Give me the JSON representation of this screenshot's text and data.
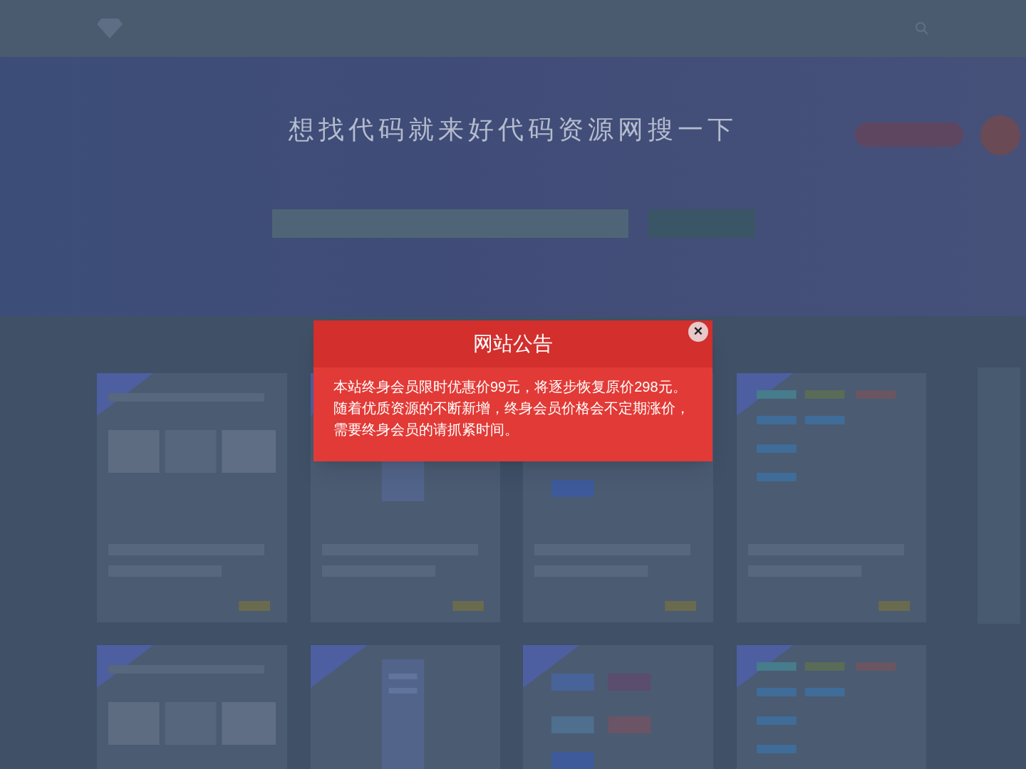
{
  "hero": {
    "title": "想找代码就来好代码资源网搜一下"
  },
  "notice": {
    "title": "网站公告",
    "body": "本站终身会员限时优惠价99元，将逐步恢复原价298元。随着优质资源的不断新增，终身会员价格会不定期涨价，需要终身会员的请抓紧时间。",
    "close": "×"
  }
}
